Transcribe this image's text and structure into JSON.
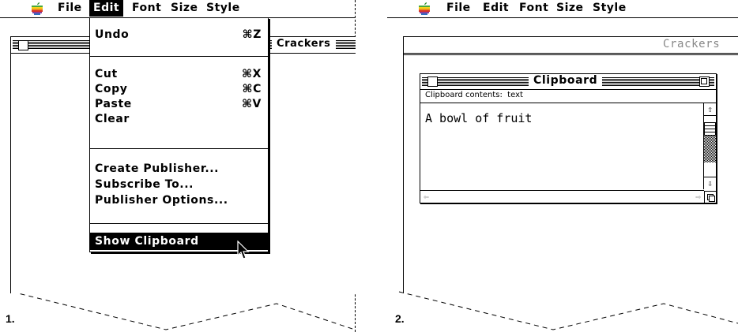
{
  "menubar": {
    "items": [
      "File",
      "Edit",
      "Font",
      "Size",
      "Style"
    ],
    "active": "Edit"
  },
  "panel1": {
    "label": "1.",
    "doc_title": "Crackers",
    "menu": {
      "undo": {
        "label": "Undo",
        "shortcut": "⌘Z"
      },
      "cut": {
        "label": "Cut",
        "shortcut": "⌘X"
      },
      "copy": {
        "label": "Copy",
        "shortcut": "⌘C"
      },
      "paste": {
        "label": "Paste",
        "shortcut": "⌘V"
      },
      "clear": {
        "label": "Clear"
      },
      "create_publisher": {
        "label": "Create Publisher..."
      },
      "subscribe_to": {
        "label": "Subscribe To..."
      },
      "publisher_options": {
        "label": "Publisher Options..."
      },
      "show_clipboard": {
        "label": "Show Clipboard"
      }
    }
  },
  "panel2": {
    "label": "2.",
    "doc_title": "Crackers",
    "clipboard": {
      "title": "Clipboard",
      "info": "Clipboard contents:  text",
      "content": "A bowl of fruit"
    }
  }
}
